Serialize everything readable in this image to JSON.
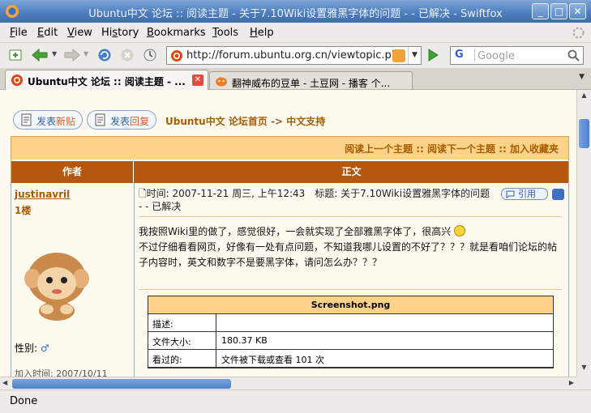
{
  "window": {
    "title": "Ubuntu中文 论坛 :: 阅读主题 - 关于7.10Wiki设置雅黑字体的问题 - - 已解决 - Swiftfox"
  },
  "menu": {
    "items": [
      {
        "label": "File",
        "key": "F"
      },
      {
        "label": "Edit",
        "key": "E"
      },
      {
        "label": "View",
        "key": "V"
      },
      {
        "label": "History",
        "key": "s"
      },
      {
        "label": "Bookmarks",
        "key": "B"
      },
      {
        "label": "Tools",
        "key": "T"
      },
      {
        "label": "Help",
        "key": "H"
      }
    ]
  },
  "navbar": {
    "url": "http://forum.ubuntu.org.cn/viewtopic.php",
    "search_placeholder": "Google",
    "search_engine": "G"
  },
  "tabs": [
    {
      "label": "Ubuntu中文 论坛 :: 阅读主题 - ...",
      "active": true
    },
    {
      "label": "翻神威布的豆单 - 土豆网 - 播客 个...",
      "active": false
    }
  ],
  "page": {
    "new_topic": {
      "prefix": "发表",
      "highlight": "新贴"
    },
    "reply": {
      "prefix": "发表",
      "highlight": "回复"
    },
    "breadcrumb": {
      "home": "Ubuntu中文 论坛首页",
      "sep": " -> ",
      "forum": "中文支持"
    },
    "top_links": "阅读上一个主题 :: 阅读下一个主题 :: 加入收藏夹",
    "col_author": "作者",
    "col_body": "正文",
    "post": {
      "author": "justinavril",
      "floor": "1楼",
      "gender_label": "性别:",
      "gender_symbol": "♂",
      "joined": "加入时间: 2007/10/11",
      "meta": "时间: 2007-11-21 周三, 上午12:43　标题: 关于7.10Wiki设置雅黑字体的问题 - - 已解决",
      "quote_label": "引用",
      "body_line1": "我按照Wiki里的做了，感觉很好，一会就实现了全部雅黑字体了，很高兴",
      "body_line2": "不过仔细看看网页，好像有一处有点问题，不知道我哪儿设置的不好了？？？就是看咱们论坛的帖子内容时，英文和数字不是要黑字体，请问怎么办？？？",
      "attachment": {
        "filename": "Screenshot.png",
        "rows": [
          {
            "key": "描述:",
            "value": ""
          },
          {
            "key": "文件大小:",
            "value": "180.37 KB"
          },
          {
            "key": "看过的:",
            "value": "文件被下载或查看 101 次"
          }
        ]
      }
    }
  },
  "status": {
    "text": "Done"
  },
  "colors": {
    "titlebar": "#4f7fc0",
    "header_bar": "#b4580e",
    "link": "#a65d00",
    "toplinks_bg": "#ffd28a"
  }
}
